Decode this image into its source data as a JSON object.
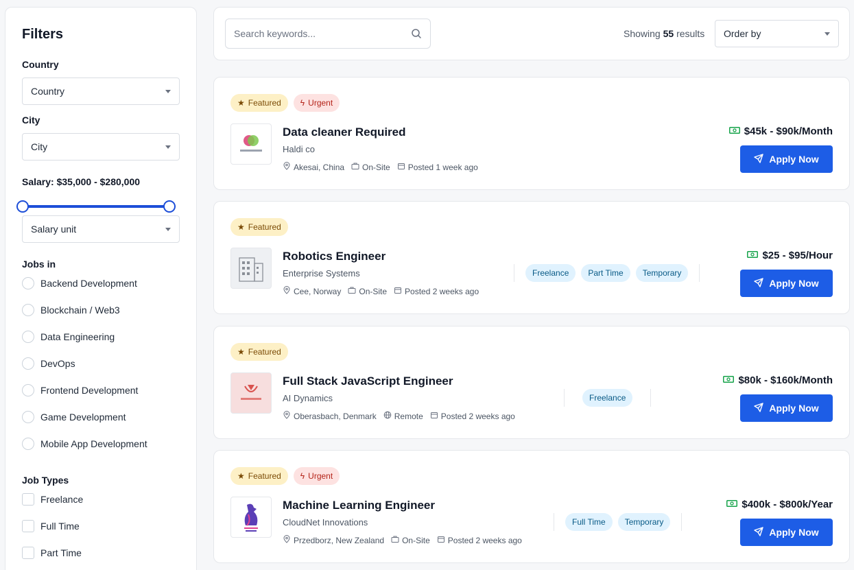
{
  "filters": {
    "title": "Filters",
    "country_label": "Country",
    "country_value": "Country",
    "city_label": "City",
    "city_value": "City",
    "salary_label": "Salary: $35,000 - $280,000",
    "salary_range": {
      "min": 35000,
      "max": 280000
    },
    "salary_unit_value": "Salary unit",
    "jobs_in_label": "Jobs in",
    "jobs_in": [
      "Backend Development",
      "Blockchain / Web3",
      "Data Engineering",
      "DevOps",
      "Frontend Development",
      "Game Development",
      "Mobile App Development"
    ],
    "job_types_label": "Job Types",
    "job_types": [
      "Freelance",
      "Full Time",
      "Part Time"
    ]
  },
  "topbar": {
    "search_placeholder": "Search keywords...",
    "showing_prefix": "Showing",
    "result_count": "55",
    "showing_suffix": "results",
    "order_by": "Order by"
  },
  "jobs": [
    {
      "badges": {
        "featured": "Featured",
        "urgent": "Urgent"
      },
      "title": "Data cleaner Required",
      "company": "Haldi co",
      "location": "Akesai, China",
      "work_mode": "On-Site",
      "posted": "Posted 1 week ago",
      "tags": [],
      "salary": "$45k - $90k/Month",
      "apply": "Apply Now"
    },
    {
      "badges": {
        "featured": "Featured"
      },
      "title": "Robotics Engineer",
      "company": "Enterprise Systems",
      "location": "Cee, Norway",
      "work_mode": "On-Site",
      "posted": "Posted 2 weeks ago",
      "tags": [
        "Freelance",
        "Part Time",
        "Temporary"
      ],
      "salary": "$25 - $95/Hour",
      "apply": "Apply Now"
    },
    {
      "badges": {
        "featured": "Featured"
      },
      "title": "Full Stack JavaScript Engineer",
      "company": "AI Dynamics",
      "location": "Oberasbach, Denmark",
      "work_mode": "Remote",
      "posted": "Posted 2 weeks ago",
      "tags": [
        "Freelance"
      ],
      "salary": "$80k - $160k/Month",
      "apply": "Apply Now"
    },
    {
      "badges": {
        "featured": "Featured",
        "urgent": "Urgent"
      },
      "title": "Machine Learning Engineer",
      "company": "CloudNet Innovations",
      "location": "Przedborz, New Zealand",
      "work_mode": "On-Site",
      "posted": "Posted 2 weeks ago",
      "tags": [
        "Full Time",
        "Temporary"
      ],
      "salary": "$400k - $800k/Year",
      "apply": "Apply Now"
    }
  ],
  "colors": {
    "primary": "#1d5de6",
    "featured_bg": "#fdf0c6",
    "urgent_bg": "#fde2e1",
    "tag_bg": "#e0f2fe",
    "money_green": "#16a34a"
  }
}
